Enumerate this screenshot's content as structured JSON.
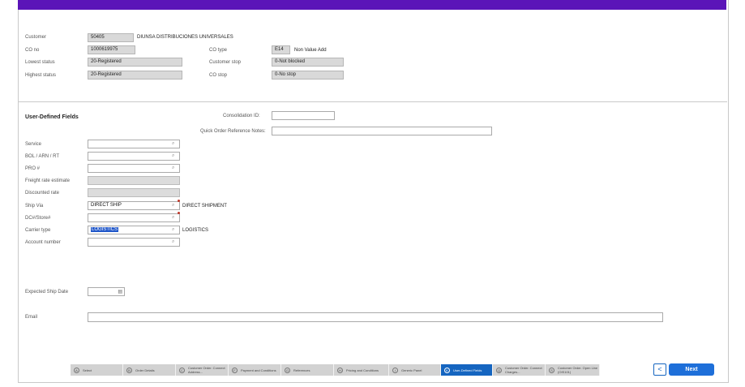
{
  "header": {
    "customer_label": "Customer",
    "customer_no": "50405",
    "customer_name": "DIUNSA DISTRIBUCIONES UNIVERSALES",
    "co_no_label": "CO no",
    "co_no": "1000619975",
    "co_type_label": "CO type",
    "co_type": "E14",
    "co_type_desc": "Non Value Add",
    "lowest_status_label": "Lowest status",
    "lowest_status": "20-Registered",
    "customer_stop_label": "Customer stop",
    "customer_stop": "0-Not blocked",
    "highest_status_label": "Highest status",
    "highest_status": "20-Registered",
    "co_stop_label": "CO stop",
    "co_stop": "0-No stop"
  },
  "section": {
    "title": "User-Defined Fields",
    "consolidation_label": "Consolidation ID:",
    "consolidation_value": "",
    "quick_notes_label": "Quick Order Reference Notes:",
    "quick_notes_value": ""
  },
  "fields": {
    "service_label": "Service",
    "service_value": "",
    "bol_label": "BOL / ARN / RT",
    "bol_value": "",
    "pro_label": "PRO #",
    "pro_value": "",
    "freight_label": "Freight rate estimate",
    "discounted_label": "Discounted rate",
    "ship_via_label": "Ship Via",
    "ship_via_value": "DIRECT SHIP",
    "ship_via_desc": "DIRECT SHIPMENT",
    "dc_label": "DC#/Store#",
    "dc_value": "",
    "carrier_label": "Carrier type",
    "carrier_value": "LOGISTICS",
    "carrier_desc": "LOGISTICS",
    "account_label": "Account number",
    "account_value": "",
    "ship_date_label": "Expected Ship Date",
    "email_label": "Email",
    "email_value": ""
  },
  "steps": [
    {
      "letter": "A",
      "label": "Select"
    },
    {
      "letter": "B",
      "label": "Order Details"
    },
    {
      "letter": "C",
      "label": "Customer Order. Connect Address..."
    },
    {
      "letter": "F",
      "label": "Payment and Conditions"
    },
    {
      "letter": "G",
      "label": "References"
    },
    {
      "letter": "H",
      "label": "Pricing and Conditions"
    },
    {
      "letter": "I",
      "label": "Generic Panel"
    },
    {
      "letter": "K",
      "label": "User-Defined Fields"
    },
    {
      "letter": "Q",
      "label": "Customer Order. Connect Charges..."
    },
    {
      "letter": "S",
      "label": "Customer Order. Open Line (OIS101)"
    }
  ],
  "nav": {
    "back_symbol": "<",
    "next_label": "Next"
  },
  "colors": {
    "top_bar": "#5b14b8",
    "active_step": "#1565c0",
    "next_button": "#1e6fd9"
  },
  "icons": {
    "field_search": "search-icon",
    "date_picker": "calendar-icon",
    "back": "chevron-left-icon"
  }
}
